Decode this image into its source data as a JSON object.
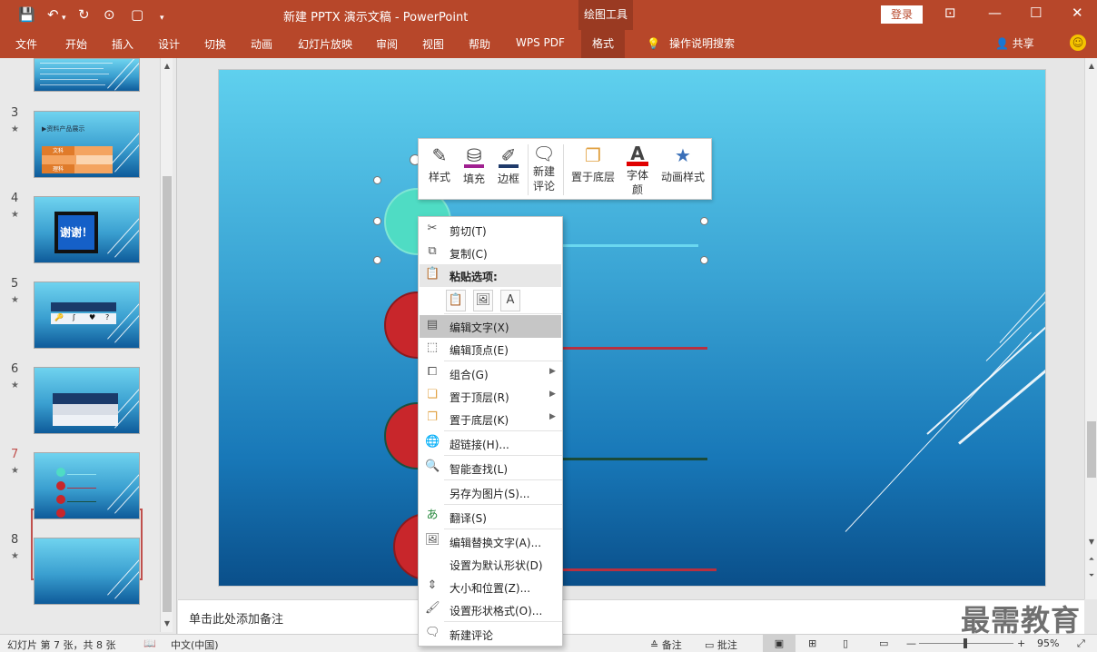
{
  "titlebar": {
    "title": "新建 PPTX 演示文稿  -  PowerPoint",
    "context_tool_title": "绘图工具",
    "login_label": "登录"
  },
  "ribbon": {
    "tabs": [
      "文件",
      "开始",
      "插入",
      "设计",
      "切换",
      "动画",
      "幻灯片放映",
      "审阅",
      "视图",
      "帮助",
      "WPS PDF",
      "格式"
    ],
    "search_label": "操作说明搜索",
    "share_label": "共享"
  },
  "slides": {
    "items": [
      {
        "number": "3",
        "star": "★"
      },
      {
        "number": "4",
        "star": "★",
        "text": "谢谢！"
      },
      {
        "number": "5",
        "star": "★"
      },
      {
        "number": "6",
        "star": "★"
      },
      {
        "number": "7",
        "star": "★"
      },
      {
        "number": "8",
        "star": "★"
      }
    ],
    "thumb3_title": "▶资料产品展示",
    "thumb3_cells": [
      "文科",
      "理科"
    ],
    "thumb5_symbols": [
      "🔑",
      "ʃ",
      "♥",
      "?"
    ]
  },
  "mini_toolbar": {
    "items": [
      {
        "label": "样式"
      },
      {
        "label": "填充"
      },
      {
        "label": "边框"
      },
      {
        "label": "新建\n评论",
        "line1": "新建",
        "line2": "评论"
      },
      {
        "label": "置于底层"
      },
      {
        "label": "字体颜",
        "line1": "字体",
        "line2": "颜"
      },
      {
        "label": "动画样式"
      }
    ]
  },
  "context_menu": {
    "items": [
      {
        "label": "剪切(T)",
        "icon": "scissors-icon"
      },
      {
        "label": "复制(C)",
        "icon": "copy-icon"
      },
      {
        "label": "粘贴选项:",
        "icon": "paste-icon"
      },
      {
        "label": "编辑文字(X)",
        "icon": "edit-text-icon"
      },
      {
        "label": "编辑顶点(E)",
        "icon": "edit-points-icon"
      },
      {
        "label": "组合(G)",
        "icon": "group-icon"
      },
      {
        "label": "置于顶层(R)",
        "icon": "bring-front-icon"
      },
      {
        "label": "置于底层(K)",
        "icon": "send-back-icon"
      },
      {
        "label": "超链接(H)...",
        "icon": "hyperlink-icon"
      },
      {
        "label": "智能查找(L)",
        "icon": "smart-lookup-icon"
      },
      {
        "label": "另存为图片(S)..."
      },
      {
        "label": "翻译(S)",
        "icon": "translate-icon"
      },
      {
        "label": "编辑替换文字(A)...",
        "icon": "alt-text-icon"
      },
      {
        "label": "设置为默认形状(D)"
      },
      {
        "label": "大小和位置(Z)...",
        "icon": "size-position-icon"
      },
      {
        "label": "设置形状格式(O)...",
        "icon": "format-shape-icon"
      },
      {
        "label": "新建评论",
        "icon": "new-comment-icon"
      }
    ]
  },
  "notes": {
    "placeholder": "单击此处添加备注"
  },
  "statusbar": {
    "slide_info": "幻灯片 第 7 张，共 8 张",
    "language": "中文(中国)",
    "notes_label": "备注",
    "comments_label": "批注",
    "zoom": "95%"
  },
  "watermark": {
    "text": "最需教育"
  },
  "colors": {
    "accent": "#b7472a",
    "slide_top": "#5fd0ee",
    "slide_bottom": "#0a4f8a",
    "teal_circle": "#4fdcc4",
    "red_circle": "#c8262b",
    "selected_slide_border": "#c0504d"
  }
}
